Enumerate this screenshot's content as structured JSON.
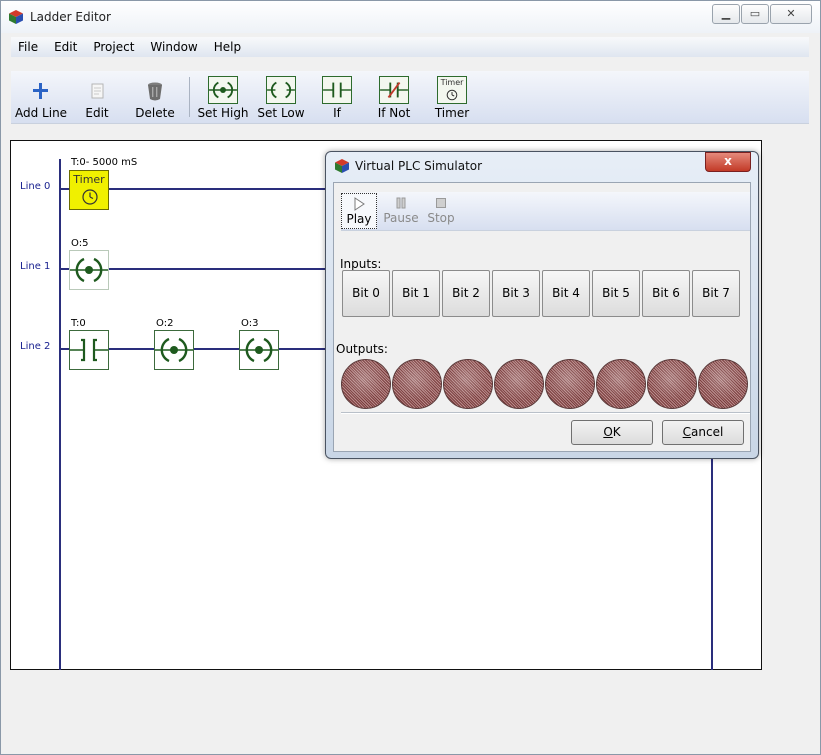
{
  "window": {
    "title": "Ladder Editor"
  },
  "menu": [
    "File",
    "Edit",
    "Project",
    "Window",
    "Help"
  ],
  "toolbar": {
    "add_line": "Add Line",
    "edit": "Edit",
    "delete": "Delete",
    "set_high": "Set High",
    "set_low": "Set Low",
    "if": "If",
    "if_not": "If Not",
    "timer": "Timer",
    "timer_icon_text": "Timer"
  },
  "ladder": {
    "lines": [
      "Line 0",
      "Line 1",
      "Line 2"
    ],
    "line0": {
      "timer_label": "T:0- 5000 mS",
      "timer_text": "Timer"
    },
    "line1": {
      "coil_label": "O:5"
    },
    "line2": {
      "contact_label": "T:0",
      "coil1_label": "O:2",
      "coil2_label": "O:3"
    }
  },
  "simulator": {
    "title": "Virtual PLC Simulator",
    "close": "x",
    "play": "Play",
    "pause": "Pause",
    "stop": "Stop",
    "inputs_label": "Inputs:",
    "outputs_label": "Outputs:",
    "bits": [
      "Bit 0",
      "Bit 1",
      "Bit 2",
      "Bit 3",
      "Bit 4",
      "Bit 5",
      "Bit 6",
      "Bit 7"
    ],
    "ok_letter": "O",
    "ok_rest": "K",
    "cancel_letter": "C",
    "cancel_rest": "ancel"
  },
  "colors": {
    "rail": "#2a2e7c",
    "timer_fill": "#f0f000",
    "element_green": "#1e5a1e"
  }
}
